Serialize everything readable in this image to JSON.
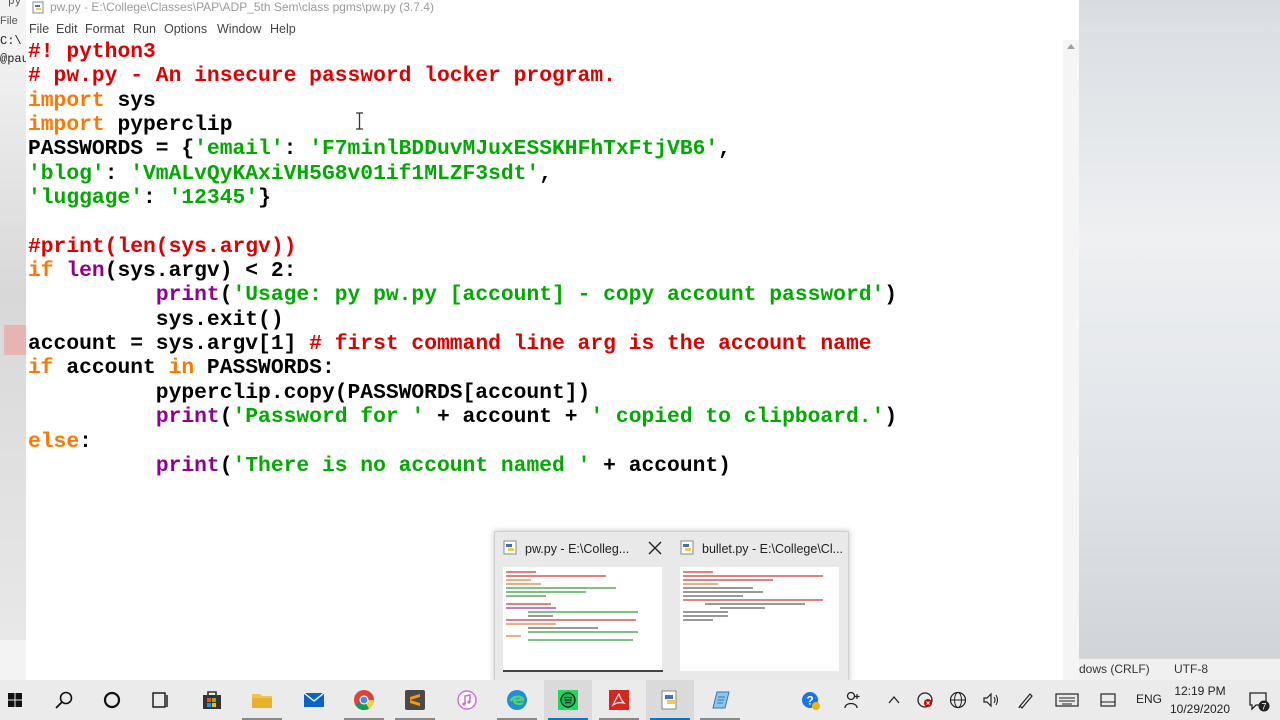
{
  "window": {
    "title": "pw.py - E:\\College\\Classes\\PAP\\ADP_5th Sem\\class pgms\\pw.py (3.7.4)"
  },
  "menu": [
    "File",
    "Edit",
    "Format",
    "Run",
    "Options",
    "Window",
    "Help"
  ],
  "background_left": {
    "lines": [
      "File",
      "C:\\",
      "@pau"
    ],
    "top_text": "py"
  },
  "code_lines": [
    [
      {
        "t": "#! python3",
        "c": "cm"
      }
    ],
    [
      {
        "t": "# pw.py - An insecure password locker program.",
        "c": "cm"
      }
    ],
    [
      {
        "t": "import",
        "c": "kw"
      },
      {
        "t": " sys",
        "c": ""
      }
    ],
    [
      {
        "t": "import",
        "c": "kw"
      },
      {
        "t": " pyperclip",
        "c": ""
      }
    ],
    [
      {
        "t": "PASSWORDS = {",
        "c": ""
      },
      {
        "t": "'email'",
        "c": "str"
      },
      {
        "t": ": ",
        "c": ""
      },
      {
        "t": "'F7minlBDDuvMJuxESSKHFhTxFtjVB6'",
        "c": "str"
      },
      {
        "t": ",",
        "c": ""
      }
    ],
    [
      {
        "t": "'blog'",
        "c": "str"
      },
      {
        "t": ": ",
        "c": ""
      },
      {
        "t": "'VmALvQyKAxiVH5G8v01if1MLZF3sdt'",
        "c": "str"
      },
      {
        "t": ",",
        "c": ""
      }
    ],
    [
      {
        "t": "'luggage'",
        "c": "str"
      },
      {
        "t": ": ",
        "c": ""
      },
      {
        "t": "'12345'",
        "c": "str"
      },
      {
        "t": "}",
        "c": ""
      }
    ],
    [
      {
        "t": "",
        "c": ""
      }
    ],
    [
      {
        "t": "#print(len(sys.argv))",
        "c": "cm"
      }
    ],
    [
      {
        "t": "if",
        "c": "kw"
      },
      {
        "t": " ",
        "c": ""
      },
      {
        "t": "len",
        "c": "bi"
      },
      {
        "t": "(sys.argv) < 2:",
        "c": ""
      }
    ],
    [
      {
        "t": "          ",
        "c": ""
      },
      {
        "t": "print",
        "c": "bi"
      },
      {
        "t": "(",
        "c": ""
      },
      {
        "t": "'Usage: py pw.py [account] - copy account password'",
        "c": "str"
      },
      {
        "t": ")",
        "c": ""
      }
    ],
    [
      {
        "t": "          sys.exit()",
        "c": ""
      }
    ],
    [
      {
        "t": "account = sys.argv[1] ",
        "c": ""
      },
      {
        "t": "# first command line arg is the account name",
        "c": "cm"
      }
    ],
    [
      {
        "t": "if",
        "c": "kw"
      },
      {
        "t": " account ",
        "c": ""
      },
      {
        "t": "in",
        "c": "kw"
      },
      {
        "t": " PASSWORDS:",
        "c": ""
      }
    ],
    [
      {
        "t": "          pyperclip.copy(PASSWORDS[account])",
        "c": ""
      }
    ],
    [
      {
        "t": "          ",
        "c": ""
      },
      {
        "t": "print",
        "c": "bi"
      },
      {
        "t": "(",
        "c": ""
      },
      {
        "t": "'Password for '",
        "c": "str"
      },
      {
        "t": " + account + ",
        "c": ""
      },
      {
        "t": "' copied to clipboard.'",
        "c": "str"
      },
      {
        "t": ")",
        "c": ""
      }
    ],
    [
      {
        "t": "else",
        "c": "kw"
      },
      {
        "t": ":",
        "c": ""
      }
    ],
    [
      {
        "t": "          ",
        "c": ""
      },
      {
        "t": "print",
        "c": "bi"
      },
      {
        "t": "(",
        "c": ""
      },
      {
        "t": "'There is no account named '",
        "c": "str"
      },
      {
        "t": " + account)",
        "c": ""
      }
    ]
  ],
  "thumbnails": [
    {
      "title": "pw.py - E:\\Colleg...",
      "active": true
    },
    {
      "title": "bullet.py - E:\\College\\Cl...",
      "active": false
    }
  ],
  "statusbar_right": {
    "line_ending": "dows (CRLF)",
    "encoding": "UTF-8"
  },
  "taskbar": {
    "items": [
      "windows-start-icon",
      "search-icon",
      "cortana-icon",
      "task-view-icon",
      "store-icon",
      "file-explorer-icon",
      "mail-icon",
      "chrome-icon",
      "sublime-text-icon",
      "itunes-icon",
      "edge-icon",
      "spotify-icon",
      "acrobat-icon",
      "python-idle-icon",
      "notepad-icon"
    ],
    "language": "ENG",
    "time": "12:19 PM",
    "date": "10/29/2020",
    "notifications": "7"
  },
  "colors": {
    "keyword": "#ff7700",
    "string": "#00aa00",
    "comment": "#dd0000",
    "builtin": "#900090"
  }
}
